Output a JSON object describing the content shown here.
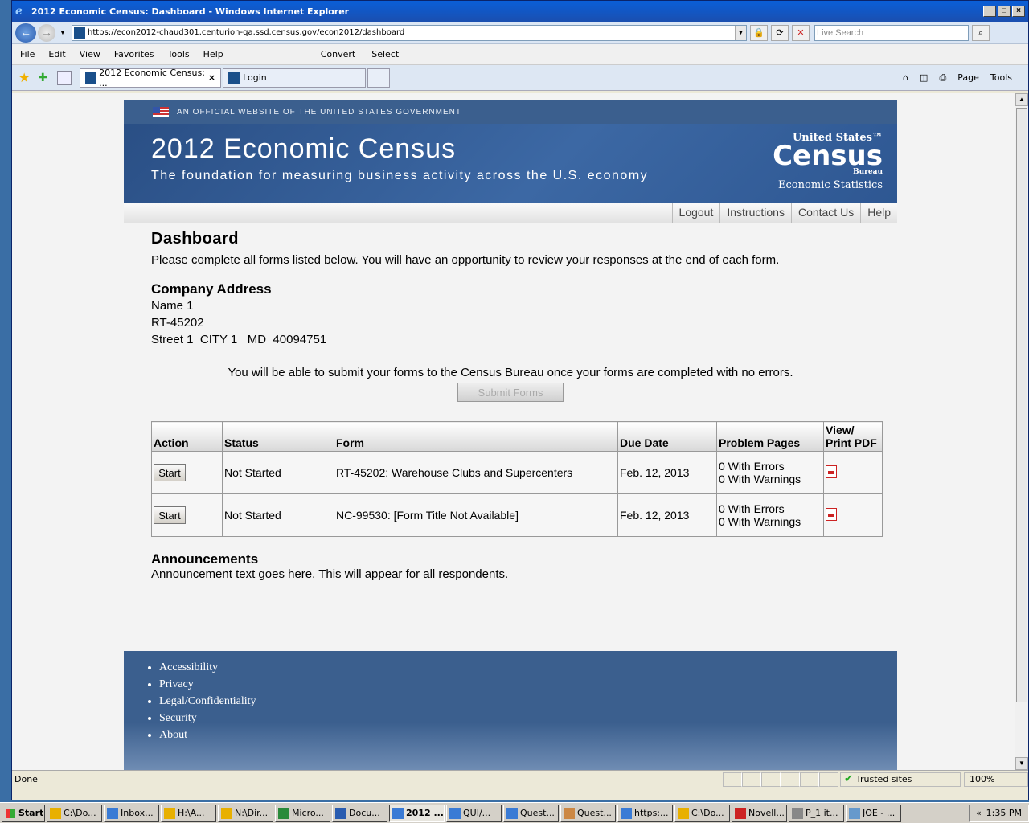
{
  "window": {
    "title": "2012 Economic Census: Dashboard - Windows Internet Explorer"
  },
  "address_bar": {
    "url": "https://econ2012-chaud301.centurion-qa.ssd.census.gov/econ2012/dashboard",
    "search_placeholder": "Live Search"
  },
  "menu": {
    "items": [
      "File",
      "Edit",
      "View",
      "Favorites",
      "Tools",
      "Help"
    ],
    "convert_label": "Convert",
    "select_label": "Select"
  },
  "tabs": [
    {
      "label": "2012 Economic Census: ..."
    },
    {
      "label": "Login"
    }
  ],
  "command_bar": {
    "page_label": "Page",
    "tools_label": "Tools"
  },
  "page": {
    "gov_banner": "AN OFFICIAL WEBSITE OF THE UNITED STATES GOVERNMENT",
    "site_title": "2012 Economic Census",
    "site_subtitle": "The foundation for measuring business activity across the U.S. economy",
    "logo": {
      "line1": "United States™",
      "line2": "Census",
      "line3": "Bureau",
      "line4": "Economic Statistics"
    },
    "nav": [
      "Logout",
      "Instructions",
      "Contact Us",
      "Help"
    ],
    "heading": "Dashboard",
    "intro": "Please complete all forms listed below. You will have an opportunity to review your responses at the end of each form.",
    "company_heading": "Company Address",
    "address": [
      "Name 1",
      "RT-45202",
      "Street 1  CITY 1   MD  40094751"
    ],
    "submit_note": "You will be able to submit your forms to the Census Bureau once your forms are completed with no errors.",
    "submit_label": "Submit Forms",
    "table": {
      "headers": [
        "Action",
        "Status",
        "Form",
        "Due Date",
        "Problem Pages",
        "View/ Print PDF"
      ],
      "rows": [
        {
          "action": "Start",
          "status": "Not Started",
          "form": "RT-45202: Warehouse Clubs and Supercenters",
          "due": "Feb. 12, 2013",
          "errors": "0 With Errors",
          "warnings": "0 With Warnings"
        },
        {
          "action": "Start",
          "status": "Not Started",
          "form": "NC-99530: [Form Title Not Available]",
          "due": "Feb. 12, 2013",
          "errors": "0 With Errors",
          "warnings": "0 With Warnings"
        }
      ]
    },
    "announcements_heading": "Announcements",
    "announcement_text": "Announcement text goes here. This will appear for all respondents.",
    "footer_links": [
      "Accessibility",
      "Privacy",
      "Legal/Confidentiality",
      "Security",
      "About"
    ]
  },
  "status_bar": {
    "text": "Done",
    "zone": "Trusted sites",
    "zoom": "100%"
  },
  "taskbar": {
    "start_label": "Start",
    "items": [
      "C:\\Do...",
      "Inbox...",
      "H:\\A...",
      "N:\\Dir...",
      "Micro...",
      "Docu...",
      "2012 ...",
      "QUI/...",
      "Quest...",
      "Quest...",
      "https:...",
      "C:\\Do...",
      "Novell...",
      "P_1 it...",
      "JOE - ..."
    ],
    "clock": "1:35 PM"
  }
}
